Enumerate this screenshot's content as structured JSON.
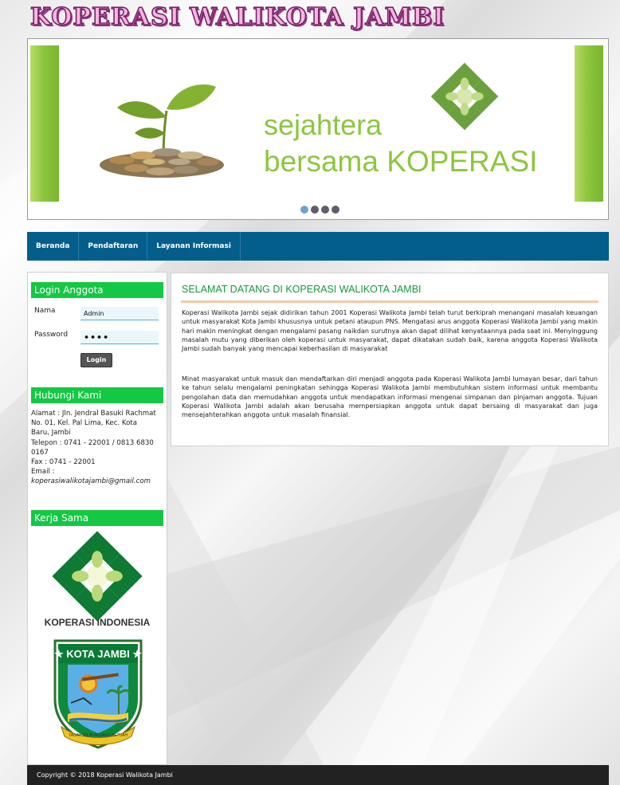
{
  "header": {
    "site_title": "KOPERASI WALIKOTA JAMBI"
  },
  "slider": {
    "slogan_line1": "sejahtera",
    "slogan_line2": "bersama KOPERASI",
    "dot_count": 4,
    "active_dot": 1
  },
  "nav": {
    "items": [
      {
        "label": "Beranda"
      },
      {
        "label": "Pendaftaran"
      },
      {
        "label": "Layanan Informasi"
      }
    ]
  },
  "login": {
    "heading": "Login Anggota",
    "name_label": "Nama",
    "name_value": "Admin",
    "password_label": "Password",
    "password_value": "••••",
    "button_label": "Login"
  },
  "contact": {
    "heading": "Hubungi Kami",
    "lines": [
      "Alamat : Jln. Jendral Basuki Rachmat",
      "No. 01, Kel. Pal Lima, Kec. Kota",
      "Baru, Jambi",
      "Telepon : 0741 - 22001 / 0813 6830",
      "0167",
      "Fax : 0741 - 22001",
      "Email :",
      "koperasiwalikotajambi@gmail.com"
    ]
  },
  "partners": {
    "heading": "Kerja Sama",
    "koperasi_label": "KOPERASI INDONESIA",
    "emblem_top_text": "★ KOTA JAMBI ★",
    "emblem_ribbon_text": "TANAH PILIH PESAKO BETUAH"
  },
  "main": {
    "title": "SELAMAT DATANG DI KOPERASI WALIKOTA JAMBI",
    "paragraph1": "Koperasi Walikota Jambi sejak didirikan tahun 2001 Koperasi Walikota Jambi telah turut berkiprah menangani masalah keuangan untuk masyarakat Kota Jambi khususnya untuk petani ataupun PNS. Mengatasi arus anggota Koperasi Walikota Jambi yang makin hari makin meningkat dengan mengalami pasang naikdan surutnya akan dapat dilihat kenyataannya pada saat ini. Menyinggung masalah mutu yang diberikan oleh koperasi untuk masyarakat, dapat dikatakan sudah baik, karena anggota Koperasi Walikota Jambi sudah banyak yang mencapai keberhasilan di masyarakat",
    "paragraph2": "Minat masyarakat untuk masuk dan mendaftarkan diri menjadi anggota pada Koperasi Walikota Jambi lumayan besar, dari tahun ke tahun selalu mengalami peningkatan sehingga Koperasi Walikota Jambi membutuhkan sistem informasi untuk membantu pengolahan data dan memudahkan anggota untuk mendapatkan informasi mengenai simpanan dan pinjaman anggota. Tujuan Koperasi Walikota Jambi adalah akan berusaha mempersiapkan anggota untuk dapat bersaing di masyarakat dan juga mensejahterahkan anggota untuk masalah finansial."
  },
  "footer": {
    "copyright": "Copyright © 2018 Koperasi Walikota Jambi"
  },
  "colors": {
    "nav_bg": "#045e8b",
    "box_header": "#13c843",
    "accent_green": "#8dc63f",
    "title_green": "#149a3a",
    "footer_bg": "#222222"
  }
}
